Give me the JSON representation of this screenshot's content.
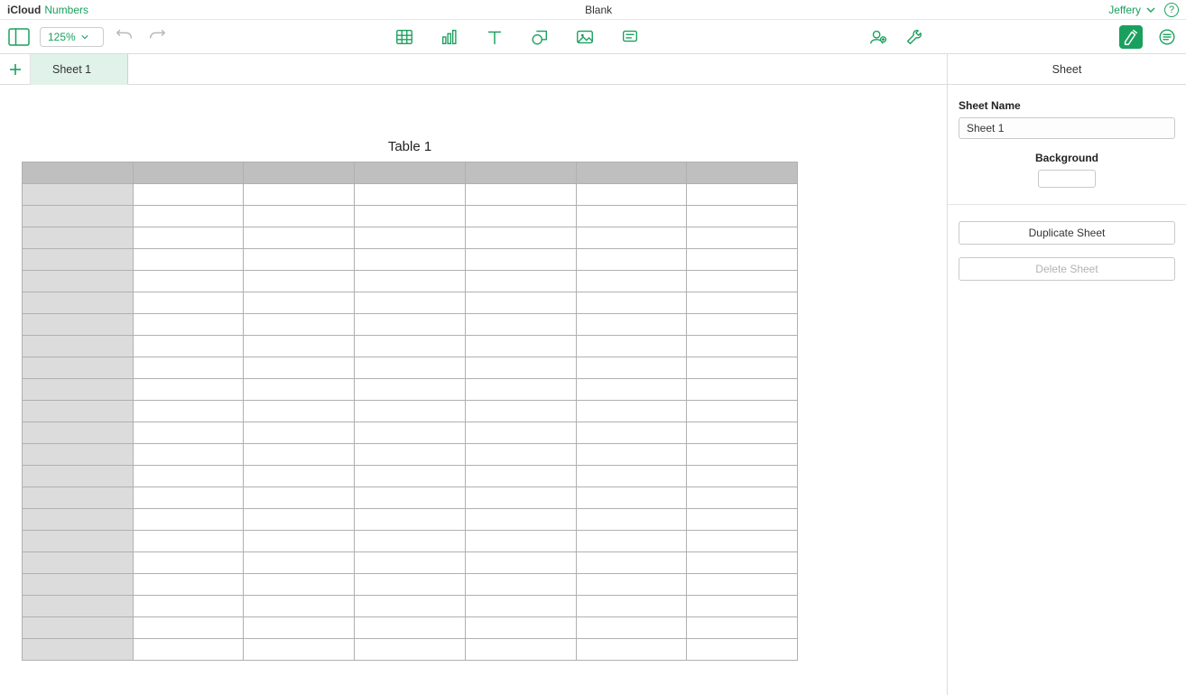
{
  "header": {
    "brand_prefix": "iCloud",
    "app_name": "Numbers",
    "document_title": "Blank",
    "user_name": "Jeffery"
  },
  "toolbar": {
    "zoom": "125%"
  },
  "tabs": {
    "sheet_tab": "Sheet 1",
    "inspector_tab": "Sheet"
  },
  "canvas": {
    "table_title": "Table 1",
    "columns": 7,
    "rows": 22
  },
  "inspector": {
    "sheet_name_label": "Sheet Name",
    "sheet_name_value": "Sheet 1",
    "background_label": "Background",
    "background_color": "#ffffff",
    "duplicate_label": "Duplicate Sheet",
    "delete_label": "Delete Sheet"
  }
}
